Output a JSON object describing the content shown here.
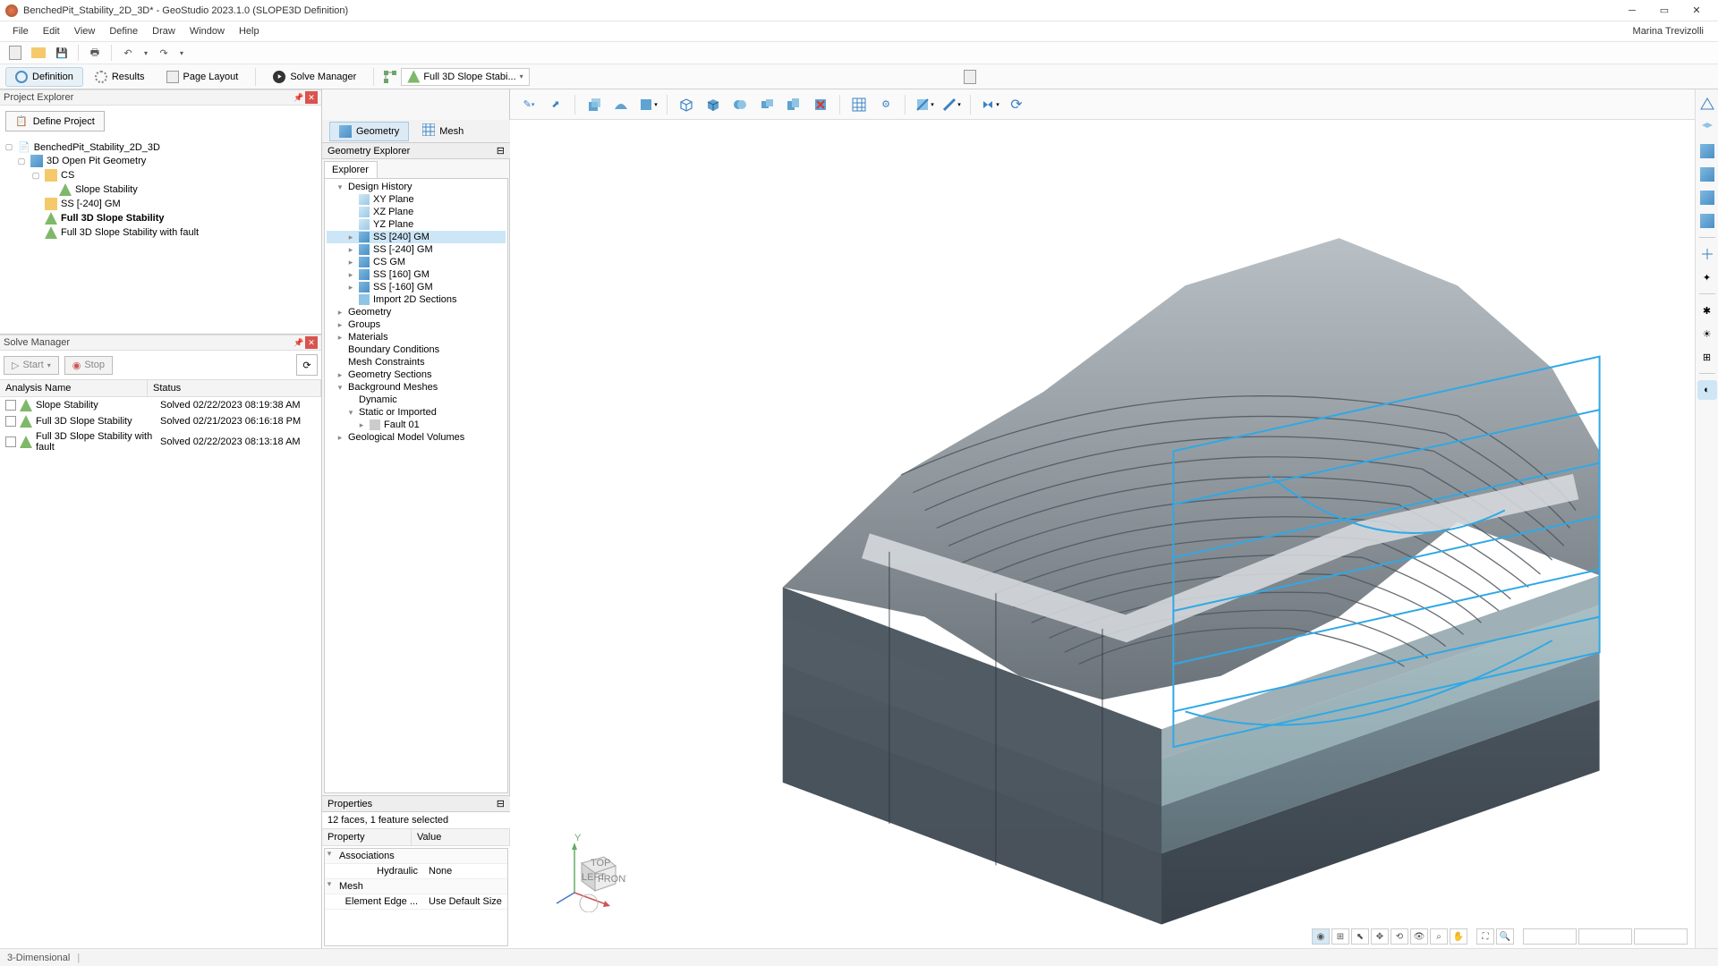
{
  "titlebar": {
    "title": "BenchedPit_Stability_2D_3D* - GeoStudio 2023.1.0 (SLOPE3D Definition)"
  },
  "menubar": {
    "items": [
      "File",
      "Edit",
      "View",
      "Define",
      "Draw",
      "Window",
      "Help"
    ],
    "user": "Marina Trevizolli"
  },
  "ribbon": {
    "definition": "Definition",
    "results": "Results",
    "page_layout": "Page Layout",
    "solve_manager": "Solve Manager",
    "analysis_dropdown": "Full 3D Slope Stabi..."
  },
  "project_explorer": {
    "title": "Project Explorer",
    "define_project": "Define Project",
    "tree": {
      "root": "BenchedPit_Stability_2D_3D",
      "geom": "3D Open Pit Geometry",
      "cs": "CS",
      "slope_stability": "Slope Stability",
      "ss_neg240": "SS [-240] GM",
      "full3d": "Full 3D Slope Stability",
      "full3d_fault": "Full 3D Slope Stability with fault"
    }
  },
  "solve_manager": {
    "title": "Solve Manager",
    "start": "Start",
    "stop": "Stop",
    "col_name": "Analysis Name",
    "col_status": "Status",
    "rows": [
      {
        "name": "Slope Stability",
        "status": "Solved 02/22/2023 08:19:38 AM"
      },
      {
        "name": "Full 3D Slope Stability",
        "status": "Solved 02/21/2023 06:16:18 PM"
      },
      {
        "name": "Full 3D Slope Stability with fault",
        "status": "Solved 02/22/2023 08:13:18 AM"
      }
    ]
  },
  "gm_tabs": {
    "geometry": "Geometry",
    "mesh": "Mesh"
  },
  "geom_explorer": {
    "title": "Geometry Explorer",
    "explorer": "Explorer",
    "design_history": "Design History",
    "xy": "XY Plane",
    "xz": "XZ Plane",
    "yz": "YZ Plane",
    "ss240": "SS [240] GM",
    "ssn240": "SS [-240] GM",
    "csgm": "CS GM",
    "ss160": "SS [160] GM",
    "ssn160": "SS [-160] GM",
    "import2d": "Import 2D Sections",
    "geometry": "Geometry",
    "groups": "Groups",
    "materials": "Materials",
    "bc": "Boundary Conditions",
    "mesh_constraints": "Mesh Constraints",
    "geom_sections": "Geometry Sections",
    "bg_meshes": "Background Meshes",
    "dynamic": "Dynamic",
    "static_imported": "Static or Imported",
    "fault01": "Fault 01",
    "geo_model_vol": "Geological Model Volumes"
  },
  "properties": {
    "title": "Properties",
    "selection": "12 faces, 1 feature selected",
    "col_prop": "Property",
    "col_val": "Value",
    "assoc": "Associations",
    "hydraulic": "Hydraulic",
    "hydraulic_val": "None",
    "mesh": "Mesh",
    "edge": "Element Edge ...",
    "edge_val": "Use Default Size"
  },
  "statusbar": {
    "text": "3-Dimensional"
  },
  "orient": {
    "top": "TOP",
    "left": "LEFT",
    "front": "FRONT",
    "y": "Y"
  }
}
